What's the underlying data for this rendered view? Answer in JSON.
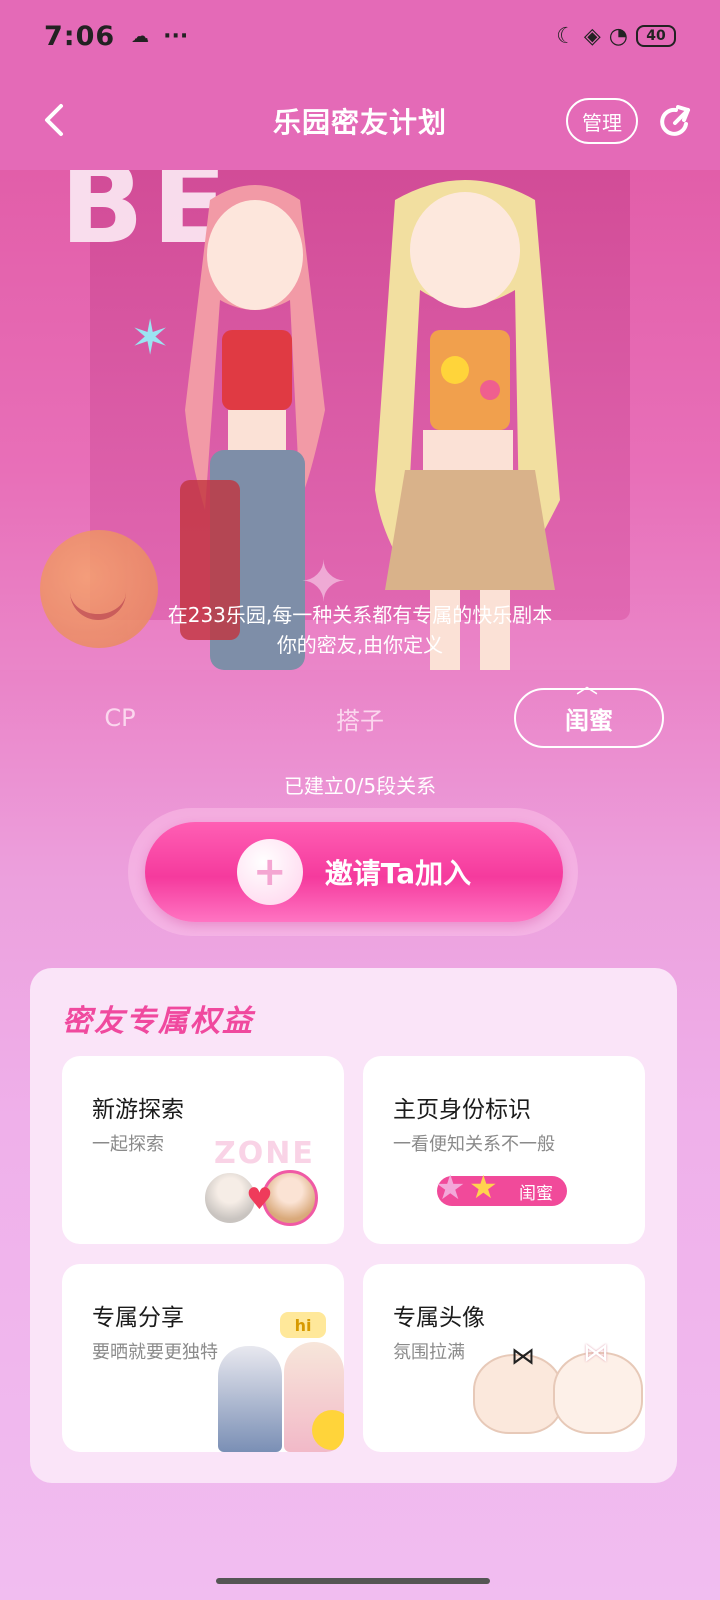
{
  "status_bar": {
    "time": "7:06",
    "more": "···",
    "battery": "40"
  },
  "header": {
    "title": "乐园密友计划",
    "manage_label": "管理"
  },
  "hero": {
    "caption_line1": "在233乐园,每一种关系都有专属的快乐剧本",
    "caption_line2": "你的密友,由你定义"
  },
  "tabs": [
    {
      "label": "CP",
      "selected": false
    },
    {
      "label": "搭子",
      "selected": false
    },
    {
      "label": "闺蜜",
      "selected": true
    }
  ],
  "relation_count": "已建立0/5段关系",
  "invite": {
    "label": "邀请Ta加入"
  },
  "benefits": {
    "title": "密友专属权益",
    "tiles": [
      {
        "title": "新游探索",
        "desc": "一起探索",
        "art_text": "ZONE"
      },
      {
        "title": "主页身份标识",
        "desc": "一看便知关系不一般",
        "badge": "闺蜜"
      },
      {
        "title": "专属分享",
        "desc": "要晒就要更独特",
        "badge": "hi"
      },
      {
        "title": "专属头像",
        "desc": "氛围拉满"
      }
    ]
  },
  "colors": {
    "header_bg": "#e46ab7",
    "accent": "#f14a9a",
    "invite_button": "#f53a9d",
    "card_bg": "#fae4f8"
  }
}
